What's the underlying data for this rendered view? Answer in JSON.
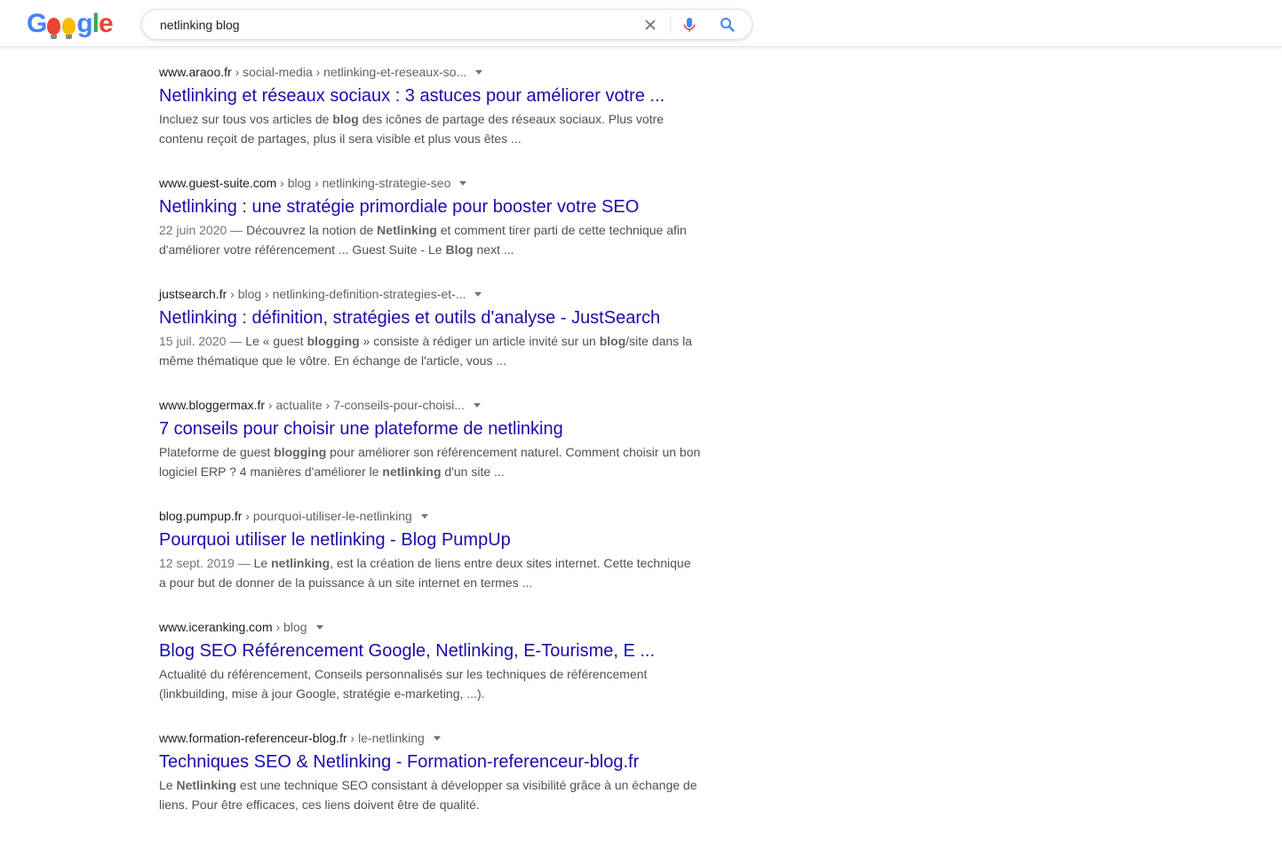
{
  "header": {
    "logo_letters": [
      {
        "t": "G",
        "color": "#4285f4"
      },
      {
        "t": "o",
        "color": "#ea4335"
      },
      {
        "t": "o",
        "color": "#fbbc05"
      },
      {
        "t": "g",
        "color": "#4285f4"
      },
      {
        "t": "l",
        "color": "#34a853"
      },
      {
        "t": "e",
        "color": "#ea4335"
      }
    ],
    "search": {
      "value": "netlinking blog"
    },
    "icons": [
      "close-icon",
      "mic-icon",
      "search-icon"
    ]
  },
  "colors": {
    "link": "#1a0dab",
    "snippet": "#4d5156",
    "cite_path": "#5f6368"
  },
  "results": [
    {
      "domain": "www.araoo.fr",
      "path": " › social-media › netlinking-et-reseaux-so...",
      "title": "Netlinking et réseaux sociaux : 3 astuces pour améliorer votre ...",
      "date": "",
      "snippet": [
        {
          "t": "Incluez sur tous vos articles de "
        },
        {
          "t": "blog",
          "b": true
        },
        {
          "t": " des icônes de partage des réseaux sociaux. Plus votre contenu reçoit de partages, plus il sera visible et plus vous êtes ..."
        }
      ]
    },
    {
      "domain": "www.guest-suite.com",
      "path": " › blog › netlinking-strategie-seo",
      "title": "Netlinking : une stratégie primordiale pour booster votre SEO",
      "date": "22 juin 2020 — ",
      "snippet": [
        {
          "t": "Découvrez la notion de "
        },
        {
          "t": "Netlinking",
          "b": true
        },
        {
          "t": " et comment tirer parti de cette technique afin d'améliorer votre référencement ... Guest Suite - Le "
        },
        {
          "t": "Blog",
          "b": true
        },
        {
          "t": " next ..."
        }
      ]
    },
    {
      "domain": "justsearch.fr",
      "path": " › blog › netlinking-definition-strategies-et-...",
      "title": "Netlinking : définition, stratégies et outils d'analyse - JustSearch",
      "date": "15 juil. 2020 — ",
      "snippet": [
        {
          "t": "Le « guest "
        },
        {
          "t": "blogging",
          "b": true
        },
        {
          "t": " » consiste à rédiger un article invité sur un "
        },
        {
          "t": "blog",
          "b": true
        },
        {
          "t": "/site dans la même thématique que le vôtre. En échange de l'article, vous ..."
        }
      ]
    },
    {
      "domain": "www.bloggermax.fr",
      "path": " › actualite › 7-conseils-pour-choisi...",
      "title": "7 conseils pour choisir une plateforme de netlinking",
      "date": "",
      "snippet": [
        {
          "t": "Plateforme de guest "
        },
        {
          "t": "blogging",
          "b": true
        },
        {
          "t": " pour améliorer son référencement naturel. Comment choisir un bon logiciel ERP ? 4 manières d'améliorer le "
        },
        {
          "t": "netlinking",
          "b": true
        },
        {
          "t": " d'un site ..."
        }
      ]
    },
    {
      "domain": "blog.pumpup.fr",
      "path": " › pourquoi-utiliser-le-netlinking",
      "title": "Pourquoi utiliser le netlinking - Blog PumpUp",
      "date": "12 sept. 2019 — ",
      "snippet": [
        {
          "t": "Le "
        },
        {
          "t": "netlinking",
          "b": true
        },
        {
          "t": ", est la création de liens entre deux sites internet. Cette technique a pour but de donner de la puissance à un site internet en termes ..."
        }
      ]
    },
    {
      "domain": "www.iceranking.com",
      "path": " › blog",
      "title": "Blog SEO Référencement Google, Netlinking, E-Tourisme, E ...",
      "date": "",
      "snippet": [
        {
          "t": "Actualité du référencement, Conseils personnalisés sur les techniques de référencement (linkbuilding, mise à jour Google, stratégie e-marketing, ...)."
        }
      ]
    },
    {
      "domain": "www.formation-referenceur-blog.fr",
      "path": " › le-netlinking",
      "title": "Techniques SEO & Netlinking - Formation-referenceur-blog.fr",
      "date": "",
      "snippet": [
        {
          "t": "Le "
        },
        {
          "t": "Netlinking",
          "b": true
        },
        {
          "t": " est une technique SEO consistant à développer sa visibilité grâce à un échange de liens. Pour être efficaces, ces liens doivent être de qualité."
        }
      ]
    }
  ]
}
